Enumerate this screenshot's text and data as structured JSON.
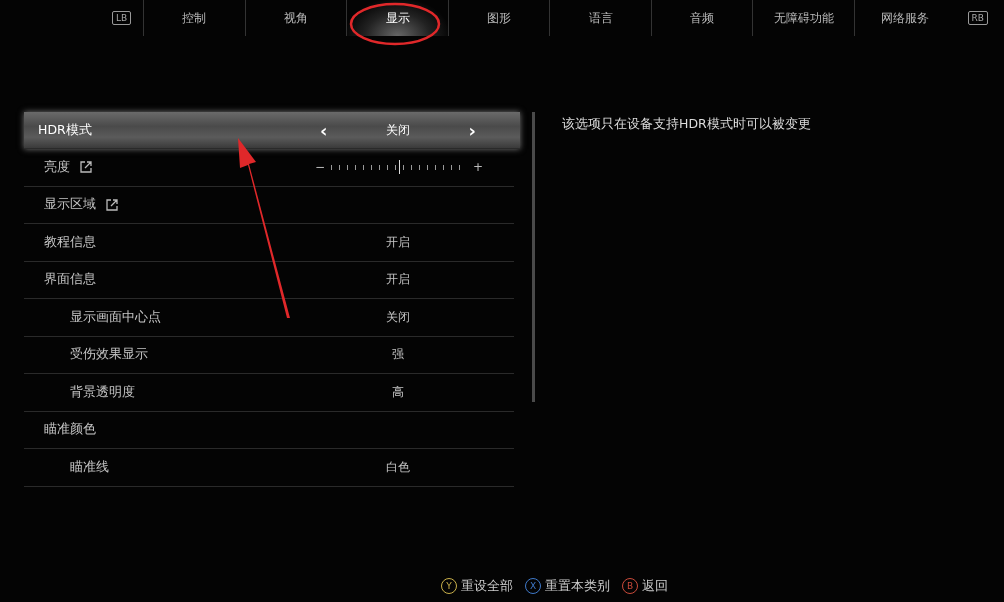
{
  "tabs": {
    "left_key": "LB",
    "right_key": "RB",
    "items": [
      {
        "label": "控制",
        "selected": false
      },
      {
        "label": "视角",
        "selected": false
      },
      {
        "label": "显示",
        "selected": true
      },
      {
        "label": "图形",
        "selected": false
      },
      {
        "label": "语言",
        "selected": false
      },
      {
        "label": "音频",
        "selected": false
      },
      {
        "label": "无障碍功能",
        "selected": false
      },
      {
        "label": "网络服务",
        "selected": false
      }
    ]
  },
  "settings": [
    {
      "kind": "select",
      "label": "HDR模式",
      "value": "关闭",
      "prev": "‹",
      "next": "›",
      "selected": true
    },
    {
      "kind": "slider",
      "label": "亮度",
      "minus": "−",
      "plus": "+",
      "level": 0.5,
      "selected": false
    },
    {
      "kind": "link",
      "label": "显示区域",
      "selected": false
    },
    {
      "kind": "value",
      "label": "教程信息",
      "value": "开启",
      "selected": false
    },
    {
      "kind": "value",
      "label": "界面信息",
      "value": "开启",
      "selected": false,
      "children": [
        {
          "kind": "value",
          "label": "显示画面中心点",
          "value": "关闭",
          "selected": false
        },
        {
          "kind": "value",
          "label": "受伤效果显示",
          "value": "强",
          "selected": false
        },
        {
          "kind": "value",
          "label": "背景透明度",
          "value": "高",
          "selected": false
        }
      ]
    },
    {
      "kind": "group",
      "label": "瞄准颜色",
      "selected": false,
      "children": [
        {
          "kind": "value",
          "label": "瞄准线",
          "value": "白色",
          "selected": false
        }
      ]
    }
  ],
  "description": "该选项只在设备支持HDR模式时可以被变更",
  "footer": [
    {
      "key": "Y",
      "label": "重设全部",
      "color": "#c9b04a"
    },
    {
      "key": "X",
      "label": "重置本类别",
      "color": "#3f79c9"
    },
    {
      "key": "B",
      "label": "返回",
      "color": "#c94a3a"
    }
  ]
}
